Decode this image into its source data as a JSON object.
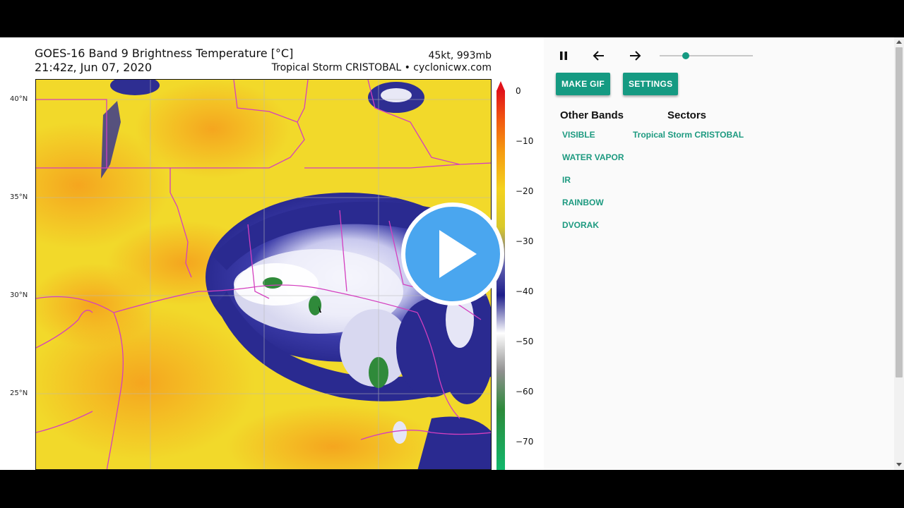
{
  "figure": {
    "title_line1": "GOES-16 Band 9 Brightness Temperature [°C]",
    "title_line2": "21:42z, Jun 07, 2020",
    "storm_stats": "45kt, 993mb",
    "storm_source": "Tropical Storm CRISTOBAL • cyclonicwx.com",
    "lat_labels": [
      "40°N",
      "35°N",
      "30°N",
      "25°N"
    ],
    "colorbar_ticks": [
      "0",
      "−10",
      "−20",
      "−30",
      "−40",
      "−50",
      "−60",
      "−70"
    ]
  },
  "controls": {
    "pause_icon": "pause-icon",
    "prev_icon": "arrow-left-icon",
    "next_icon": "arrow-right-icon",
    "slider_fraction": 0.28
  },
  "buttons": {
    "make_gif": "MAKE GIF",
    "settings": "SETTINGS"
  },
  "other_bands": {
    "heading": "Other Bands",
    "items": [
      "VISIBLE",
      "WATER VAPOR",
      "IR",
      "RAINBOW",
      "DVORAK"
    ]
  },
  "sectors": {
    "heading": "Sectors",
    "items": [
      "Tropical Storm CRISTOBAL"
    ]
  },
  "colors": {
    "accent": "#159a82",
    "link": "#1d9a80",
    "play_blue": "#4aa6ef"
  }
}
